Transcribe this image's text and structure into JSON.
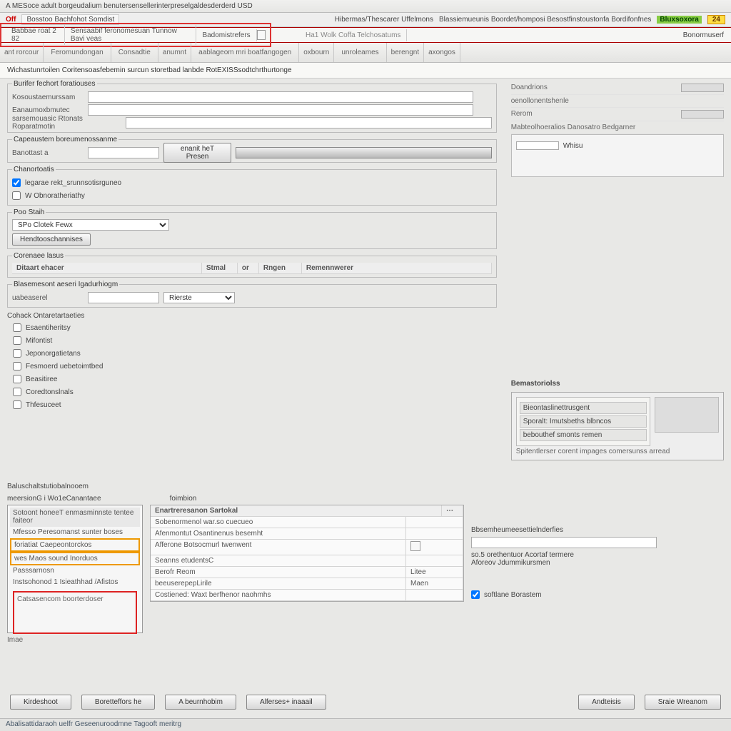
{
  "window": {
    "title": "A MESoce adult borgeudalium benutersensellerinterpreselgaldesderderd USD"
  },
  "toolbar1": {
    "brand": "Off",
    "doc": "Bosstoo Bachfohot Somdist",
    "right_a": "Hibermas/Thescarer Uffelmons",
    "right_b": "Blassiemueunis Boordet/homposi Besostfinstoustonfa Bordifonfnes",
    "badge_g": "Bluxsoxora",
    "badge_y": "24"
  },
  "toolbar2": {
    "items": [
      "Babbae roat 2 82",
      "Sensaabif feronomesuan Tunnow Bavi veas",
      "Badomistrefers"
    ],
    "mid": "Ha1   Wolk Coffa Telchosatums",
    "end": "Bonormuserf"
  },
  "ribbon": {
    "groups": [
      "ant rorcour",
      "Feromundongan",
      "Consadtie",
      "anumnt",
      "aablageom mri boatfangogen",
      "oxbourn",
      "unroleames",
      "berengnt",
      "axongos"
    ]
  },
  "pathbar": "Wichastunrtoilen Coritensoasfebemin surcun storetbad lanbde RotEXISSsodtchrthurtonge",
  "form": {
    "sec1_title": "Burifer fechort foratiouses",
    "r1": "Kosoustaemurssam",
    "r2": "Eanaumoxbmutec",
    "r3": "sarsemouasic Rtonats Roparatmotin",
    "sec2_title": "Capeaustem boreumenossanme",
    "r4_lbl": "Banottast a",
    "r4_btn": "enanit heT Presen",
    "sec3_title": "Chanortoatis",
    "chk1": "legarae rekt_srunnsotisrguneo",
    "chk2": "W Obnoratheriathy",
    "sec4_title": "Poo Staih",
    "sel1": "SPo Clotek Fewx",
    "btn_a": "Hendtooschannises",
    "sec5_title": "Corenaee lasus",
    "grid_h1": "Ditaart ehacer",
    "grid_h2": "Stmal",
    "grid_h2b": "or",
    "grid_h3": "Rngen",
    "grid_h4": "Remennwerer",
    "sec6_title": "Blasemesont aeseri Igadurhiogm",
    "r5_lbl": "uabeaserel",
    "r5_sel": "Rierste",
    "col_title": "Cohack Ontaretartaeties",
    "cols": [
      "Esaentiheritsy",
      "Mifontist",
      "Jeponorgatietans",
      "Fesmoerd uebetoimtbed",
      "Beasitiree",
      "Coredtonslnals",
      "Thfesuceet"
    ]
  },
  "rightpanel": {
    "kv1": "Doandrions",
    "kv2": "oenollonentshenle",
    "kv3": "Rerom",
    "kv4": "Mabteolhoeralios Danosatro Bedgarner",
    "swlabels": [
      "",
      "Whisu",
      ""
    ],
    "info_title": "Bemastoriolss",
    "info_items": [
      "Bieontaslinettrusgent",
      "Sporalt: Imutsbeths blbncos",
      "bebouthef smonts remen"
    ],
    "info_foot": "Spitentlerser corent impages comersunss arread"
  },
  "bottom": {
    "title": "Baluschaltstutiobalnooem",
    "sub1": "meersionG i Wo1eCanantaee",
    "sub2": "foimbion",
    "tree_head": "Sotoont honeeT enmasminnste  tentee faiteor",
    "tree_items": [
      "Mfesso Peresomanst sunter boses",
      "foriatiat Caepeontorckos",
      "wes Maos sound Inorduos",
      "Passsarnosn",
      "Instsohonod 1 Isieathhad /Afistos"
    ],
    "grid_head": "Enartreresanon Sartokal",
    "grid_rows": [
      [
        "Sobenormenol war.so cuecueo",
        ""
      ],
      [
        "Afenmontut Osantinenus besemht",
        ""
      ],
      [
        "Afferone Botsocmurl twenwent",
        ""
      ],
      [
        "Seanns etudentsC",
        ""
      ],
      [
        "Berofr Reom",
        "Litee"
      ],
      [
        "beeuserepepLirile",
        "Maen"
      ],
      [
        "Costiened: Waxt berfhenor naohmhs",
        ""
      ]
    ],
    "right_lbl1": "Bbsemheumeesettielnderfies",
    "right_lbl2": "so.5 orethentuor Acortaf termere",
    "right_lbl3": "Aforeov Jdummikursmen",
    "right_chk": "softlane Borastem"
  },
  "footer": {
    "buttons": [
      "Kirdeshoot",
      "Boretteffors he",
      "A   beurnhobim",
      "Alferses+ inaaail"
    ],
    "buttons_r": [
      "Andteisis",
      "Sraie Wreanom"
    ]
  },
  "status": "Abalisattidaraoh uelfr Geseenuroodmne Tagooft meritrg"
}
